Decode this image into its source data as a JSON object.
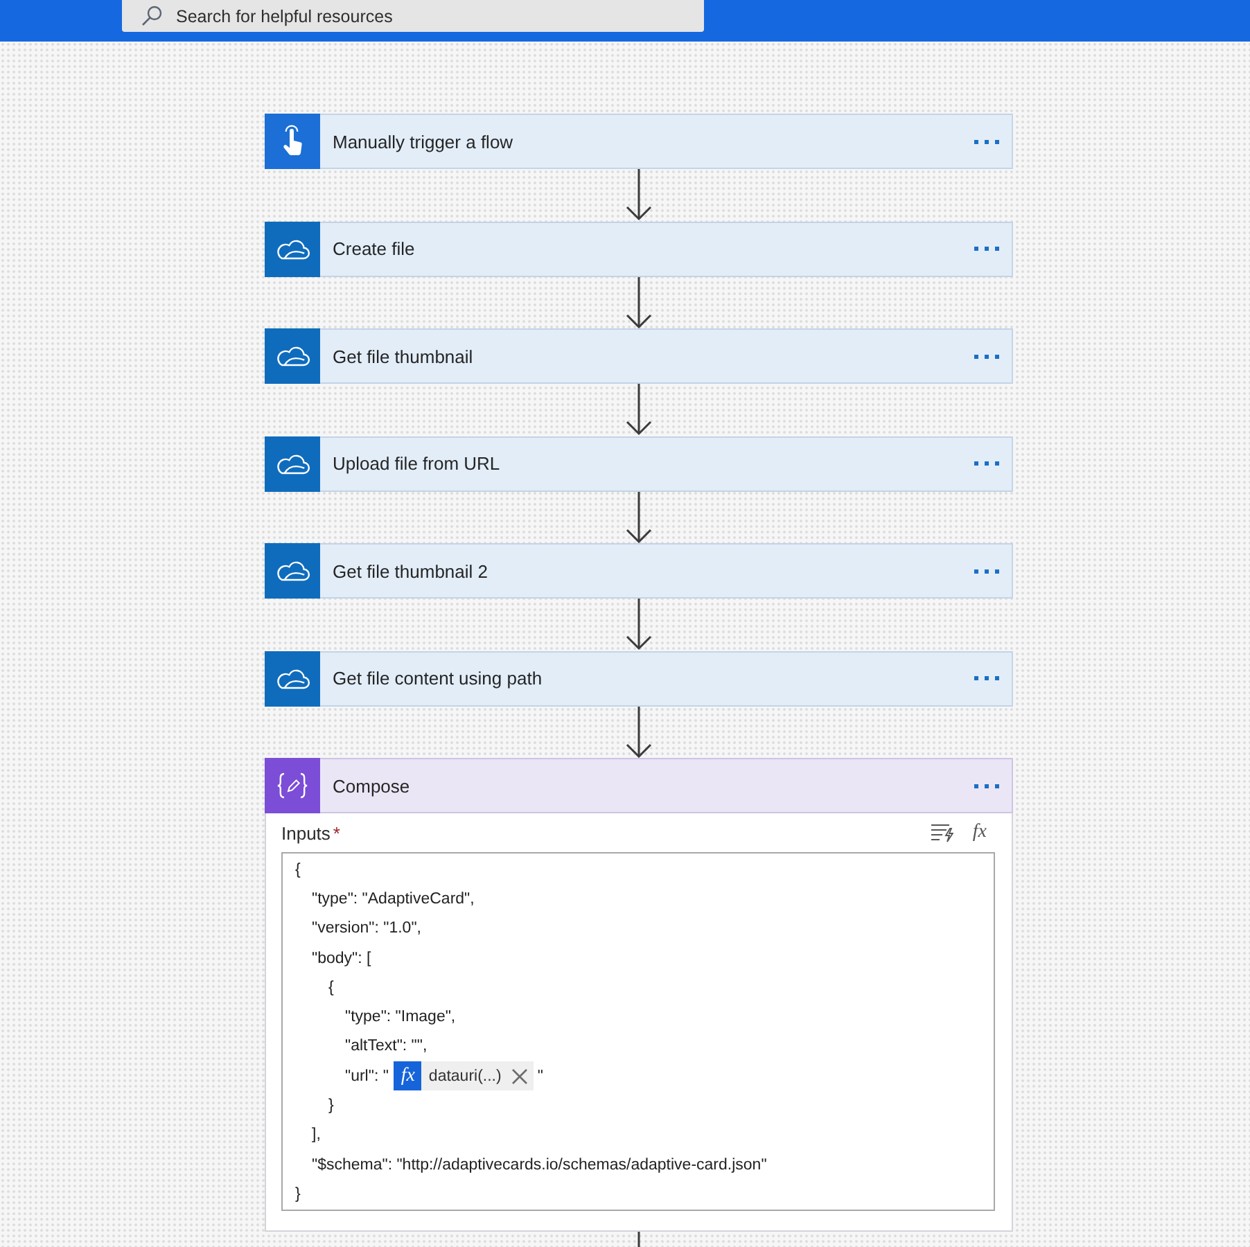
{
  "header": {
    "search": {
      "placeholder": "Search for helpful resources"
    }
  },
  "steps": [
    {
      "kind": "trigger",
      "title": "Manually trigger a flow",
      "expanded": false
    },
    {
      "kind": "onedrive",
      "title": "Create file",
      "expanded": false
    },
    {
      "kind": "onedrive",
      "title": "Get file thumbnail",
      "expanded": false
    },
    {
      "kind": "onedrive",
      "title": "Upload file from URL",
      "expanded": false
    },
    {
      "kind": "onedrive",
      "title": "Get file thumbnail 2",
      "expanded": false
    },
    {
      "kind": "onedrive",
      "title": "Get file content using path",
      "expanded": false
    },
    {
      "kind": "compose",
      "title": "Compose",
      "expanded": true,
      "inputs": {
        "label": "Inputs",
        "required_mark": "*",
        "expression_button": "fx",
        "code": [
          {
            "text": "{",
            "children": [
              {
                "text": "\"type\": \"AdaptiveCard\","
              },
              {
                "text": "\"version\": \"1.0\","
              },
              {
                "text": "\"body\": [",
                "children": [
                  {
                    "text": "{",
                    "children": [
                      {
                        "text": "\"type\": \"Image\","
                      },
                      {
                        "text": "\"altText\": \"\","
                      },
                      {
                        "text": "\"url\": \"",
                        "token": {
                          "badge": "fx",
                          "label": "datauri(...)"
                        },
                        "after": "\""
                      }
                    ]
                  },
                  {
                    "text": "}"
                  }
                ]
              },
              {
                "text": "],"
              },
              {
                "text": "\"$schema\": \"http://adaptivecards.io/schemas/adaptive-card.json\""
              }
            ]
          },
          {
            "text": "}"
          }
        ]
      }
    }
  ]
}
